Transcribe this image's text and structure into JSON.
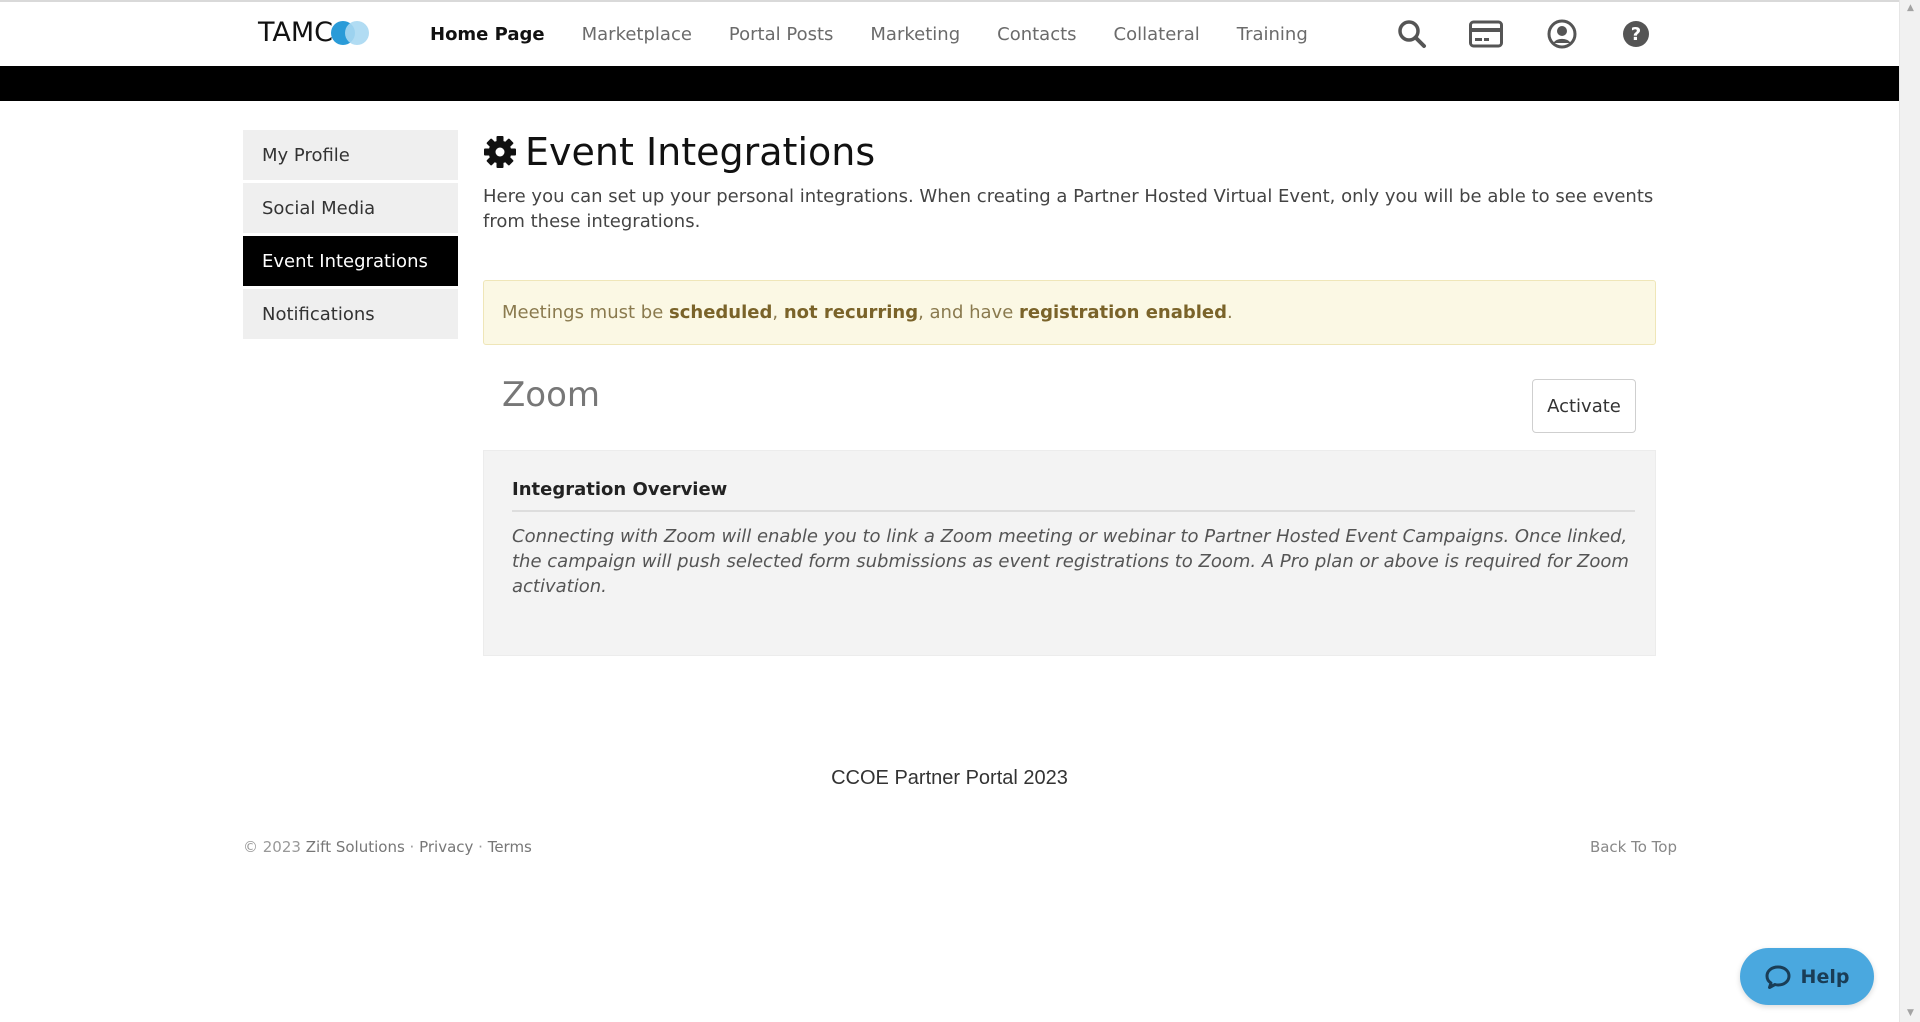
{
  "header": {
    "logo_text": "TAMC",
    "nav": [
      {
        "label": "Home Page",
        "active": true
      },
      {
        "label": "Marketplace"
      },
      {
        "label": "Portal Posts"
      },
      {
        "label": "Marketing"
      },
      {
        "label": "Contacts"
      },
      {
        "label": "Collateral"
      },
      {
        "label": "Training"
      }
    ],
    "icons": [
      "search-icon",
      "credit-card-icon",
      "user-icon",
      "help-icon"
    ]
  },
  "sidebar": {
    "items": [
      {
        "label": "My Profile"
      },
      {
        "label": "Social Media"
      },
      {
        "label": "Event Integrations",
        "active": true
      },
      {
        "label": "Notifications"
      }
    ]
  },
  "main": {
    "title": "Event Integrations",
    "intro": "Here you can set up your personal integrations. When creating a Partner Hosted Virtual Event, only you will be able to see events from these integrations.",
    "alert": {
      "prefix": "Meetings must be ",
      "b1": "scheduled",
      "sep1": ", ",
      "b2": "not recurring",
      "mid": ", and have ",
      "b3": "registration enabled",
      "suffix": "."
    },
    "integration": {
      "name": "Zoom",
      "button_label": "Activate",
      "overview_title": "Integration Overview",
      "overview_text": "Connecting with Zoom will enable you to link a Zoom meeting or webinar to Partner Hosted Event Campaigns. Once linked, the campaign will push selected form submissions as event registrations to Zoom. A Pro plan or above is required for Zoom activation."
    }
  },
  "footer": {
    "center": "CCOE Partner Portal 2023",
    "copyright": "© 2023",
    "company": "Zift Solutions",
    "dot": " · ",
    "privacy": "Privacy",
    "terms": "Terms",
    "back_to_top": "Back To Top"
  },
  "help_button": {
    "label": "Help"
  },
  "colors": {
    "accent_blue": "#2a9bd8",
    "alert_bg": "#fbf8e4",
    "active_sidebar": "#000000",
    "help_bg": "#4aa8df"
  }
}
